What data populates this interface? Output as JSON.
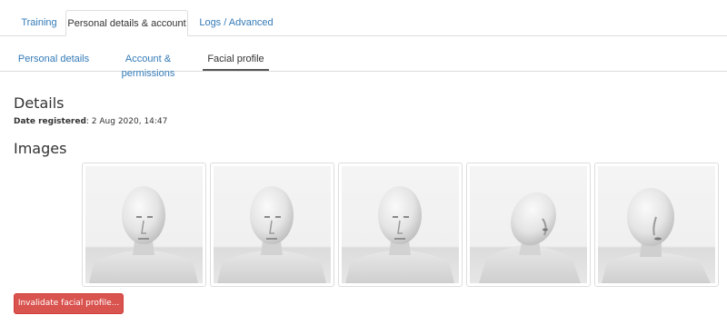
{
  "top_tabs": [
    {
      "label": "Training",
      "active": false
    },
    {
      "label": "Personal details & account",
      "active": true
    },
    {
      "label": "Logs / Advanced",
      "active": false
    }
  ],
  "sub_tabs": [
    {
      "label": "Personal details",
      "active": false
    },
    {
      "label": "Account & permissions",
      "active": false
    },
    {
      "label": "Facial profile",
      "active": true
    }
  ],
  "details": {
    "heading": "Details",
    "date_label": "Date registered",
    "date_value": ": 2 Aug 2020, 14:47"
  },
  "images": {
    "heading": "Images",
    "items": [
      {
        "pose": "frontal"
      },
      {
        "pose": "frontal"
      },
      {
        "pose": "frontal"
      },
      {
        "pose": "tilted-up"
      },
      {
        "pose": "turned-left"
      }
    ]
  },
  "actions": {
    "invalidate_label": "Invalidate facial profile..."
  },
  "colors": {
    "link": "#337ab7",
    "danger": "#d9534f",
    "border": "#dddddd"
  }
}
